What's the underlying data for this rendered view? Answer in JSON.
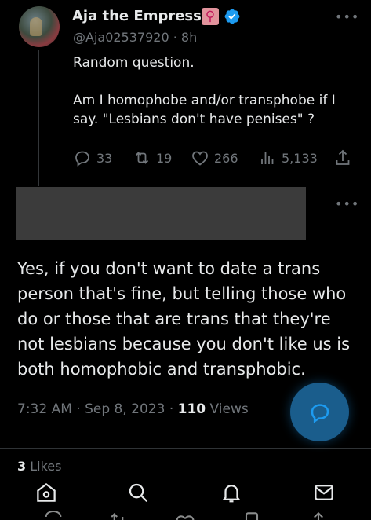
{
  "tweet": {
    "author_name": "Aja the Empress",
    "badge_glyph": "♀",
    "handle": "@Aja02537920",
    "age": "8h",
    "text": "Random question.\n\nAm I homophobe and/or transphobe if I say. \"Lesbians don't have penises\" ?",
    "counts": {
      "replies": "33",
      "retweets": "19",
      "likes": "266",
      "views": "5,133"
    }
  },
  "reply": {
    "text": "Yes, if you don't want to date a trans person that's fine, but telling those who do or those that are trans that they're not lesbians because you don't like us is both homophobic and transphobic.",
    "time": "7:32 AM · Sep 8, 2023",
    "views_count": "110",
    "views_label": "Views",
    "likes_count": "3",
    "likes_label": "Likes"
  },
  "icons": {
    "verified": "verified-badge-icon",
    "more": "more-icon",
    "reply": "reply-icon",
    "retweet": "retweet-icon",
    "like": "heart-icon",
    "views": "views-icon",
    "share": "share-icon",
    "compose": "compose-icon",
    "nav": [
      "home-icon",
      "search-icon",
      "notifications-icon",
      "messages-icon"
    ]
  },
  "colors": {
    "accent": "#1d9bf0",
    "muted": "#71767b",
    "text": "#e7e9ea",
    "background": "#000000",
    "badge": "#e2939c"
  }
}
